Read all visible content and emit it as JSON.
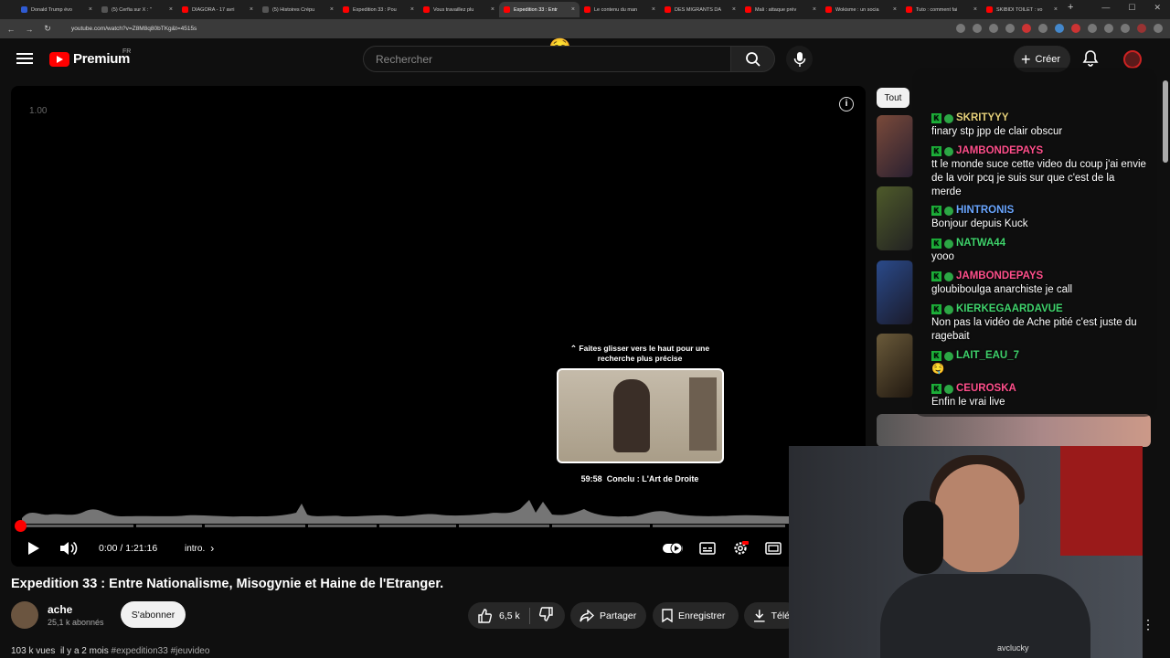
{
  "browser": {
    "tabs": [
      {
        "label": "Donald Trump évo",
        "fav": "t"
      },
      {
        "label": "(5) Cerfia sur X : \"",
        "fav": "x"
      },
      {
        "label": "DIAGORA - 17 avri",
        "fav": "r"
      },
      {
        "label": "(5) Histoires Crépu",
        "fav": "x"
      },
      {
        "label": "Expedition 33 : Pou",
        "fav": "r"
      },
      {
        "label": "Vous travaillez plu",
        "fav": "r"
      },
      {
        "label": "Expedition 33 : Entr",
        "fav": "r"
      },
      {
        "label": "Le contenu du man",
        "fav": "r"
      },
      {
        "label": "DES MIGRANTS DA",
        "fav": "r"
      },
      {
        "label": "Mali : attaque prév",
        "fav": "r"
      },
      {
        "label": "Wokisme : un socia",
        "fav": "r"
      },
      {
        "label": "Tuto : comment fai",
        "fav": "r"
      },
      {
        "label": "SKIBIDI TOILET : vo",
        "fav": "r"
      }
    ],
    "active_tab": 6,
    "url": "youtube.com/watch?v=Z8M8q80bTKg&t=4515s"
  },
  "header": {
    "logo_word": "Premium",
    "country": "FR",
    "search_placeholder": "Rechercher",
    "create_label": "Créer"
  },
  "player": {
    "speed_overlay": "1.00",
    "preview_hint": "Faites glisser vers le haut pour une recherche plus précise",
    "preview_time": "59:58",
    "preview_chapter": "Conclu : L'Art de Droite",
    "time_display": "0:00 / 1:21:16",
    "chapter_label": "intro.",
    "progress_fraction": 0.0,
    "chapter_starts": [
      0.0,
      0.151,
      0.24,
      0.375,
      0.468,
      0.572,
      0.693,
      0.824
    ],
    "accent": "#ff0000"
  },
  "video": {
    "title": "Expedition 33 : Entre Nationalisme, Misogynie et Haine de l'Etranger.",
    "channel": "ache",
    "subscribers": "25,1 k abonnés",
    "subscribe_label": "S'abonner",
    "likes": "6,5 k",
    "share_label": "Partager",
    "save_label": "Enregistrer",
    "download_label": "Télé",
    "views": "103 k vues",
    "date": "il y a 2 mois",
    "tags": "#expedition33 #jeuvideo"
  },
  "sidebar": {
    "filter_all": "Tout",
    "bottom_channel": "avclucky"
  },
  "chat": [
    {
      "user": "SKRITYYY",
      "color": "#e5d07a",
      "message": "finary stp jpp de clair obscur"
    },
    {
      "user": "JAMBONDEPAYS",
      "color": "#ff4f8b",
      "message": "tt le monde suce cette video du coup j'ai envie de la voir pcq je suis sur que c'est de la merde"
    },
    {
      "user": "HINTRONIS",
      "color": "#6aa6ff",
      "message": "Bonjour depuis Kuck"
    },
    {
      "user": "NATWA44",
      "color": "#3fd26b",
      "message": "yooo"
    },
    {
      "user": "JAMBONDEPAYS",
      "color": "#ff4f8b",
      "message": "gloubiboulga anarchiste je call"
    },
    {
      "user": "KIERKEGAARDAVUE",
      "color": "#3fd26b",
      "message": "Non pas la vidéo de Ache pitié c'est juste du ragebait"
    },
    {
      "user": "LAIT_EAU_7",
      "color": "#3fd26b",
      "message": "🤤"
    },
    {
      "user": "CEUROSKA",
      "color": "#ff4f8b",
      "message": "Enfin le vrai live"
    }
  ]
}
